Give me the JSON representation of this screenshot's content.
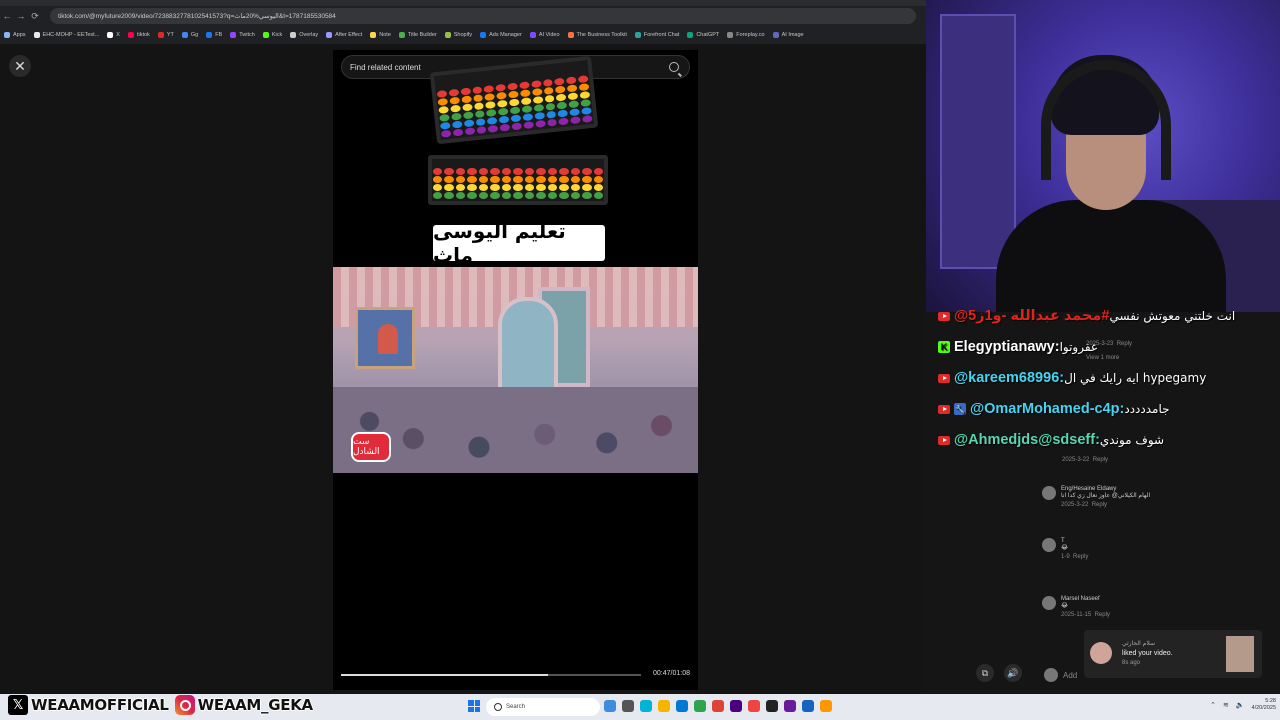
{
  "browser": {
    "url": "tiktok.com/@myfuture2009/video/7238832778102541573?q=اليوسي%20ماث&t=1787185530584",
    "bookmarks": [
      "Apps",
      "EHC-MOHP - EETest...",
      "X",
      "tiktok",
      "YT",
      "Gg",
      "FB",
      "Twitch",
      "Kick",
      "Overlay",
      "After Effect",
      "Note",
      "Title Builder",
      "Shopify",
      "Ads Manager",
      "AI Video",
      "The Business Toolkit",
      "Forefront Chat",
      "ChatGPT",
      "Foreplay.co",
      "AI Image"
    ]
  },
  "tiktok": {
    "search_placeholder": "Find related content",
    "video_title": "تعليم اليوسى ماث",
    "video_logo": "ست الشادل",
    "time": "00:47/01:08",
    "progress": 0.69
  },
  "chat": [
    {
      "platform": "youtube",
      "user": "@محمد عبدالله -و1ز5#",
      "msg": "انت خلتني معوتش نفسي",
      "color": "#e0241c"
    },
    {
      "platform": "kick",
      "user": "Elegyptianawy:",
      "msg": "عفروتوا",
      "color": "#ffffff"
    },
    {
      "platform": "youtube",
      "user": "@kareem68996:",
      "msg": "ايه رايك في ال hypegamy",
      "color": "#42d6f2"
    },
    {
      "platform": "youtube-mod",
      "user": "@OmarMohamed-c4p:",
      "msg": "جامددددد",
      "color": "#42d6f2"
    },
    {
      "platform": "youtube",
      "user": "@Ahmedjds@sdseff:",
      "msg": "شوف موندي",
      "color": "#57d6b0"
    }
  ],
  "comments": [
    {
      "name": "Eng/Hesaine Eldawy",
      "text": "الهام الكيلاني@ عاوز نعال زي كدا انا",
      "date": "2025-3-22",
      "reply": "Reply"
    },
    {
      "name": "T",
      "text": "😂",
      "date": "1-9",
      "reply": "Reply"
    },
    {
      "name": "Marsel Naseef",
      "text": "😂",
      "date": "2025-11-15",
      "reply": "Reply"
    }
  ],
  "comment_fragments": {
    "date1": "2025-3-23",
    "reply1": "Reply",
    "view_more": "View 1 more",
    "date2": "2025-3-22",
    "reply2": "Reply"
  },
  "notification": {
    "name": "سلام الحارثي",
    "text": "liked your video.",
    "time": "8s ago"
  },
  "add_comment": "Add",
  "social": {
    "x_handle": "WEAAMOFFICIAL",
    "ig_handle": "WEAAM_GEKA"
  },
  "taskbar": {
    "search": "Search",
    "time": "5:28",
    "date": "4/20/2025"
  }
}
